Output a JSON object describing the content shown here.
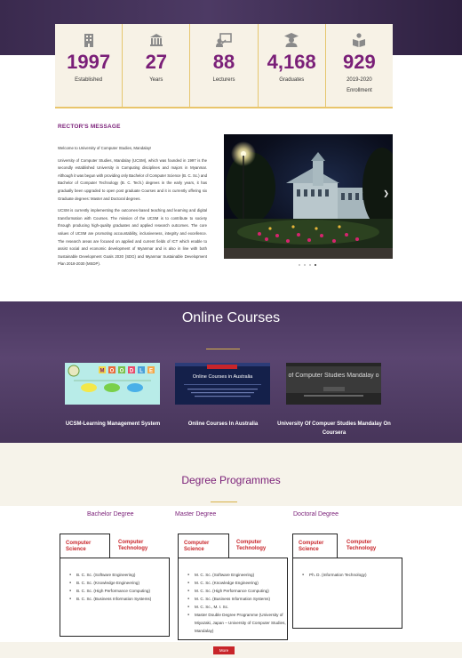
{
  "stats": [
    {
      "icon": "building-icon",
      "value": "1997",
      "label": "Established"
    },
    {
      "icon": "institution-icon",
      "value": "27",
      "label": "Years"
    },
    {
      "icon": "lecturer-icon",
      "value": "88",
      "label": "Lecturers"
    },
    {
      "icon": "graduate-icon",
      "value": "4,168",
      "label": "Graduates"
    },
    {
      "icon": "student-reading-icon",
      "value": "929",
      "label": "2019-2020",
      "label2": "Enrollment"
    }
  ],
  "rector": {
    "title": "RECTOR'S MESSAGE",
    "paragraphs": [
      "Welcome to University of Computer Studies, Mandalay!",
      "University of Computer Studies, Mandalay (UCSM), which was founded in 1997 is the secondly established University in Computing disciplines and majors in Myanmar. Although it was begun with providing only Bachelor of Computer Science (B. C. Sc.) and Bachelor of Computer Technology (B. C. Tech.) degrees in the early years, it has gradually been upgraded to open post graduate Courses and it is currently offering six Graduate degrees: Master and Doctoral degrees.",
      "UCSM is currently implementing the outcomes-based teaching and learning and digital transformation with Courses. The mission of the UCSM is to contribute to society through producing high-quality graduates and applied research outcomes. The core values of UCSM are promoting accountability, inclusiveness, integrity and excellence. The research areas are focused on applied and current fields of ICT which enable to assist social and economic development of Myanmar and is also in line with both Sustainable Development Goals 2030 (SDG) and Myanmar Sustainable Development Plan 2018-2030 (MSDP)."
    ]
  },
  "online": {
    "title": "Online Courses",
    "courses": [
      {
        "label": "UCSM-Learning Management System"
      },
      {
        "label": "Online Courses In Australia",
        "thumb_text": "Online Courses in Australia"
      },
      {
        "label": "University Of Compuer Studies Mandalay On Coursera",
        "thumb_text": "of Computer Studies Mandalay o"
      }
    ]
  },
  "degree": {
    "title": "Degree Programmes",
    "columns": [
      {
        "heading": "Bachelor Degree",
        "tab1": "Computer Science",
        "tab2": "Computer Technology",
        "items": [
          "B. C. Sc. (Software Engineering)",
          "B. C. Sc. (Knowledge Engineering)",
          "B. C. Sc. (High Performance Computing)",
          "B. C. Sc. (Business Information Systems)"
        ]
      },
      {
        "heading": "Master Degree",
        "tab1": "Computer Science",
        "tab2": "Computer Technology",
        "items": [
          "M. C. Sc. (Software Engineering)",
          "M. C. Sc. (Knowledge Engineering)",
          "M. C. Sc. (High Performance Computing)",
          "M. C. Sc. (Business Information Systems)",
          "M. C. Sc., M. I. Sc.",
          "Master Double Degree Programme (University of Miyazaki, Japan – University of Computer Studies, Mandalay)"
        ]
      },
      {
        "heading": "Doctoral Degree",
        "tab1": "Computer Science",
        "tab2": "Computer Technology",
        "items": [
          "Ph. D. (Information Technology)"
        ]
      }
    ],
    "more_label": "More"
  },
  "colors": {
    "accent": "#7a1f78",
    "gold": "#d8b24a",
    "tab_red": "#c8252a"
  }
}
